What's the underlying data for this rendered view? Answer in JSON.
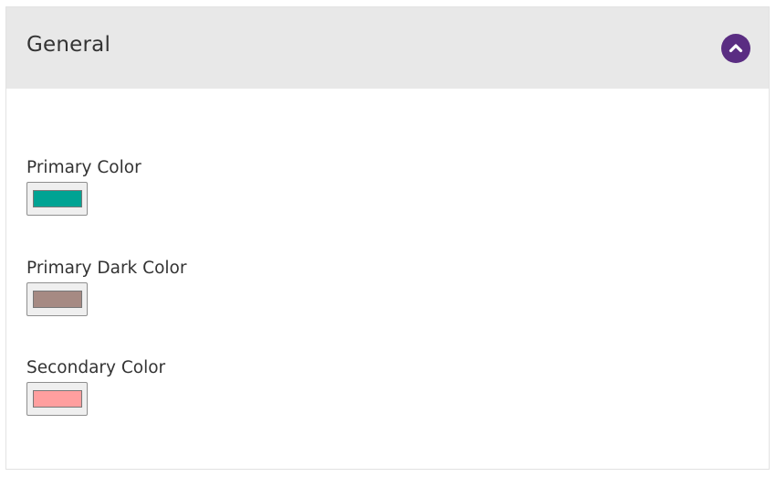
{
  "section": {
    "title": "General",
    "collapse_icon": "chevron-up-icon",
    "accent_color": "#5a2d82"
  },
  "fields": [
    {
      "label": "Primary Color",
      "value": "#00a393"
    },
    {
      "label": "Primary Dark Color",
      "value": "#a68a83"
    },
    {
      "label": "Secondary Color",
      "value": "#ff9f9f"
    }
  ]
}
